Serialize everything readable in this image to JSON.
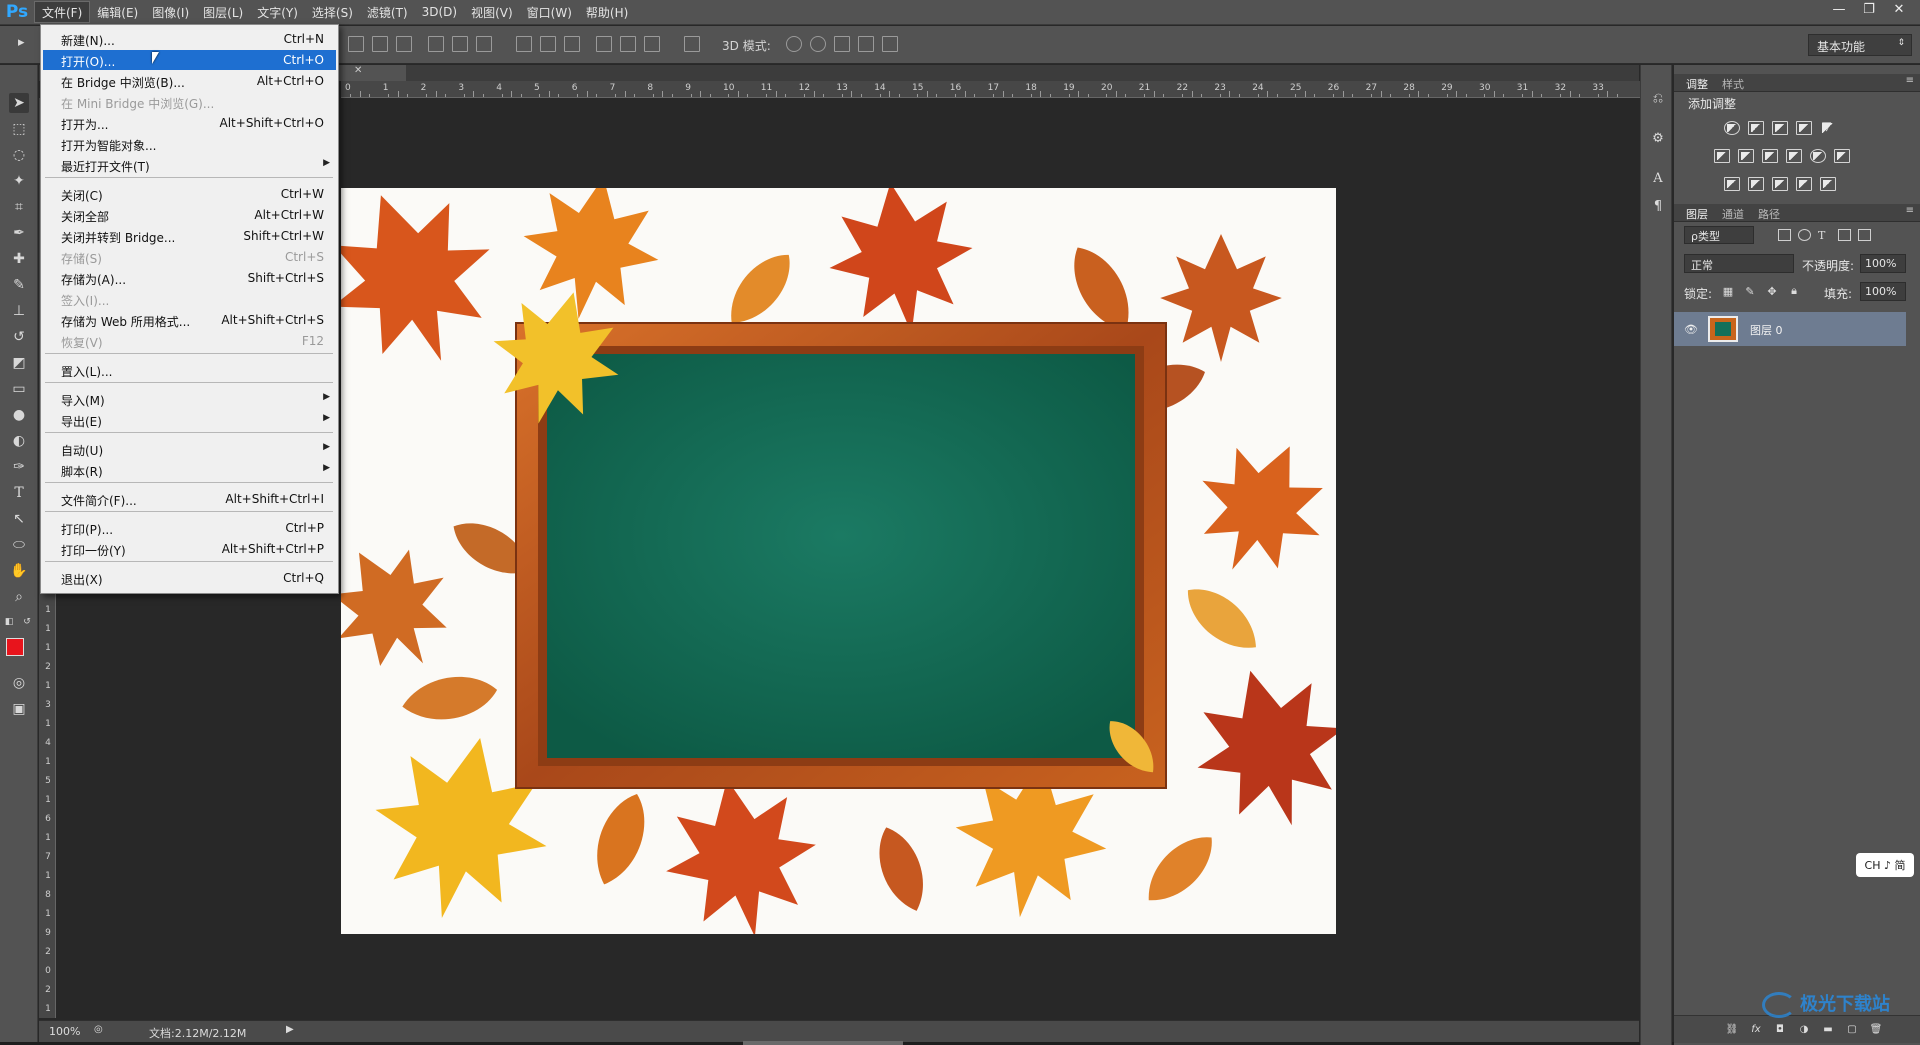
{
  "app": {
    "logo": "Ps"
  },
  "menubar": {
    "items": [
      {
        "label": "文件(F)"
      },
      {
        "label": "编辑(E)"
      },
      {
        "label": "图像(I)"
      },
      {
        "label": "图层(L)"
      },
      {
        "label": "文字(Y)"
      },
      {
        "label": "选择(S)"
      },
      {
        "label": "滤镜(T)"
      },
      {
        "label": "3D(D)"
      },
      {
        "label": "视图(V)"
      },
      {
        "label": "窗口(W)"
      },
      {
        "label": "帮助(H)"
      }
    ],
    "window_controls": [
      "—",
      "❐",
      "✕"
    ]
  },
  "options_bar": {
    "mode_3d_label": "3D 模式:",
    "workspace": "基本功能"
  },
  "file_menu": {
    "items": [
      {
        "label": "新建(N)...",
        "shortcut": "Ctrl+N"
      },
      {
        "label": "打开(O)...",
        "shortcut": "Ctrl+O",
        "highlight": true
      },
      {
        "label": "在 Bridge 中浏览(B)...",
        "shortcut": "Alt+Ctrl+O"
      },
      {
        "label": "在 Mini Bridge 中浏览(G)...",
        "shortcut": "",
        "disabled": true
      },
      {
        "label": "打开为...",
        "shortcut": "Alt+Shift+Ctrl+O"
      },
      {
        "label": "打开为智能对象...",
        "shortcut": ""
      },
      {
        "label": "最近打开文件(T)",
        "shortcut": "",
        "submenu": true
      },
      {
        "label": "关闭(C)",
        "shortcut": "Ctrl+W"
      },
      {
        "label": "关闭全部",
        "shortcut": "Alt+Ctrl+W"
      },
      {
        "label": "关闭并转到 Bridge...",
        "shortcut": "Shift+Ctrl+W"
      },
      {
        "label": "存储(S)",
        "shortcut": "Ctrl+S",
        "disabled": true
      },
      {
        "label": "存储为(A)...",
        "shortcut": "Shift+Ctrl+S"
      },
      {
        "label": "签入(I)...",
        "shortcut": "",
        "disabled": true
      },
      {
        "label": "存储为 Web 所用格式...",
        "shortcut": "Alt+Shift+Ctrl+S"
      },
      {
        "label": "恢复(V)",
        "shortcut": "F12",
        "disabled": true
      },
      {
        "label": "置入(L)...",
        "shortcut": ""
      },
      {
        "label": "导入(M)",
        "shortcut": "",
        "submenu": true
      },
      {
        "label": "导出(E)",
        "shortcut": "",
        "submenu": true
      },
      {
        "label": "自动(U)",
        "shortcut": "",
        "submenu": true
      },
      {
        "label": "脚本(R)",
        "shortcut": "",
        "submenu": true
      },
      {
        "label": "文件简介(F)...",
        "shortcut": "Alt+Shift+Ctrl+I"
      },
      {
        "label": "打印(P)...",
        "shortcut": "Ctrl+P"
      },
      {
        "label": "打印一份(Y)",
        "shortcut": "Alt+Shift+Ctrl+P"
      },
      {
        "label": "退出(X)",
        "shortcut": "Ctrl+Q"
      }
    ]
  },
  "document": {
    "ruler_labels": [
      "0",
      "1",
      "2",
      "3",
      "4",
      "5",
      "6",
      "7",
      "8",
      "9",
      "10",
      "11",
      "12",
      "13",
      "14",
      "15",
      "16",
      "17",
      "18",
      "19",
      "20",
      "21",
      "22",
      "23",
      "24",
      "25",
      "26",
      "27",
      "28",
      "29",
      "30",
      "31",
      "32",
      "33"
    ],
    "vruler_labels": [
      "1",
      "1",
      "1",
      "2",
      "1",
      "3",
      "1",
      "4",
      "1",
      "5",
      "1",
      "6",
      "1",
      "7",
      "1",
      "8",
      "1",
      "9",
      "2",
      "0",
      "2",
      "1"
    ]
  },
  "statusbar": {
    "zoom": "100%",
    "doc_size": "文档:2.12M/2.12M"
  },
  "adjustments_panel": {
    "tabs": [
      "调整",
      "样式"
    ],
    "add_label": "添加调整"
  },
  "layers_panel": {
    "tabs": [
      "图层",
      "通道",
      "路径"
    ],
    "filter": "ρ类型",
    "blend_mode": "正常",
    "opacity_label": "不透明度:",
    "opacity": "100%",
    "lock_label": "锁定:",
    "fill_label": "填充:",
    "fill": "100%",
    "layers": [
      {
        "name": "图层 0",
        "visible": true
      }
    ]
  },
  "ime_badge": "CH ♪ 简",
  "watermark": "极光下载站",
  "colors": {
    "foreground": "#e8141c",
    "background": "#ffffff",
    "highlight": "#1e6fd1",
    "chalkboard": "#14705a",
    "frame": "#b5561c"
  }
}
